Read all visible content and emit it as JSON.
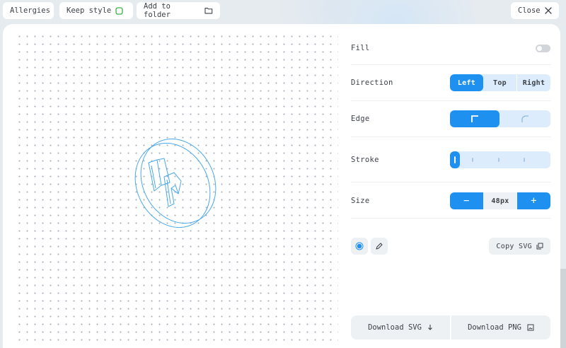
{
  "topbar": {
    "allergies_label": "Allergies",
    "keep_style_label": "Keep style",
    "add_to_folder_label": "Add to folder",
    "close_label": "Close"
  },
  "panel": {
    "fill": {
      "label": "Fill",
      "enabled": false
    },
    "direction": {
      "label": "Direction",
      "options": [
        "Left",
        "Top",
        "Right"
      ],
      "selected": "Left"
    },
    "edge": {
      "label": "Edge",
      "options": [
        "sharp-corner-icon",
        "rounded-corner-icon"
      ],
      "selected": "sharp-corner-icon"
    },
    "stroke": {
      "label": "Stroke",
      "level": 0
    },
    "size": {
      "label": "Size",
      "value": "48px",
      "decrement": "−",
      "increment": "+"
    },
    "copy_svg_label": "Copy SVG",
    "download_svg_label": "Download SVG",
    "download_png_label": "Download PNG"
  },
  "colors": {
    "accent": "#1e90f0",
    "accent_light": "#dcecfc",
    "icon_stroke": "#4aa8ea"
  },
  "icons": [
    "square-icon",
    "folder-icon",
    "close-icon",
    "color-dot-icon",
    "pencil-icon",
    "copy-icon",
    "download-arrow-icon",
    "image-icon"
  ]
}
